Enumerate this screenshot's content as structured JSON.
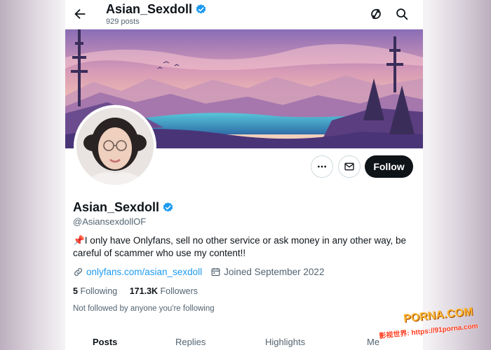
{
  "header": {
    "display_name": "Asian_Sexdoll",
    "post_count": "929 posts"
  },
  "profile": {
    "display_name": "Asian_Sexdoll",
    "handle": "@AsiansexdollOF",
    "bio": "📌I only have Onlyfans, sell no other service or ask money in any other way, be careful of scammer who use my content!!",
    "link": "onlyfans.com/asian_sexdoll",
    "joined": "Joined September 2022",
    "following_count": "5",
    "following_label": "Following",
    "followers_count": "171.3K",
    "followers_label": "Followers",
    "not_followed_text": "Not followed by anyone you're following"
  },
  "actions": {
    "follow_label": "Follow"
  },
  "tabs": [
    {
      "label": "Posts",
      "active": true
    },
    {
      "label": "Replies",
      "active": false
    },
    {
      "label": "Highlights",
      "active": false
    },
    {
      "label": "Me",
      "active": false
    }
  ],
  "watermark": {
    "title": "PORNA.COM",
    "url": "影视世界: https://91porna.com"
  },
  "colors": {
    "verified": "#1d9bf0",
    "link": "#1d9bf0",
    "follow_button": "#0f1419"
  },
  "icons": [
    "back-arrow-icon",
    "verified-icon",
    "refresh-icon",
    "search-icon",
    "more-icon",
    "message-icon",
    "link-icon",
    "calendar-icon"
  ]
}
